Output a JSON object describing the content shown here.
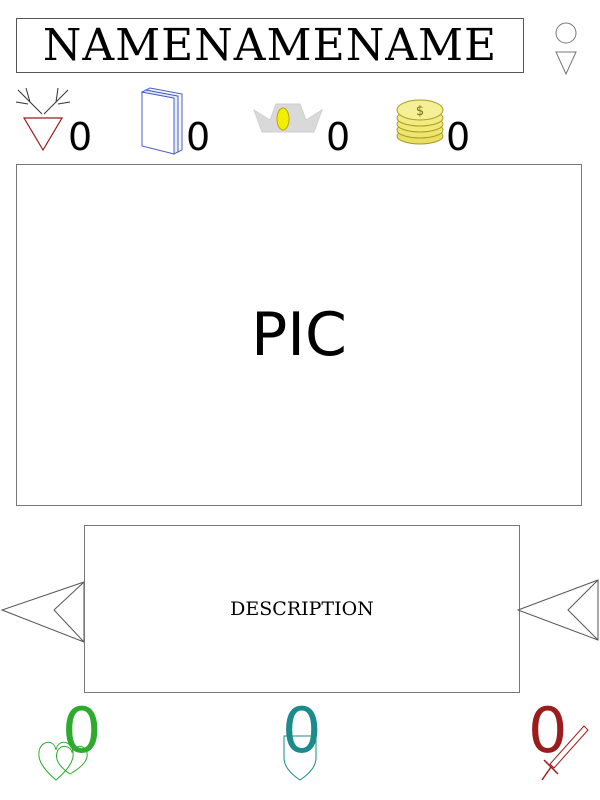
{
  "header": {
    "name": "NAMENAMENAME",
    "menu_icon": "person-silhouette-icon"
  },
  "stats": [
    {
      "icon": "antler-shield-icon",
      "value": "0"
    },
    {
      "icon": "book-icon",
      "value": "0"
    },
    {
      "icon": "crown-icon",
      "value": "0"
    },
    {
      "icon": "coin-stack-icon",
      "value": "0"
    }
  ],
  "picture": {
    "label": "PIC"
  },
  "description": {
    "label": "DESCRIPTION"
  },
  "navigation": {
    "prev_icon": "left-arrow-icon",
    "next_icon": "right-arrow-icon"
  },
  "bottom_stats": [
    {
      "icon": "hearts-icon",
      "value": "0",
      "color": "#2eaa2e"
    },
    {
      "icon": "shield-icon",
      "value": "0",
      "color": "#1b8b8b"
    },
    {
      "icon": "sword-icon",
      "value": "0",
      "color": "#9b1c1c"
    }
  ]
}
